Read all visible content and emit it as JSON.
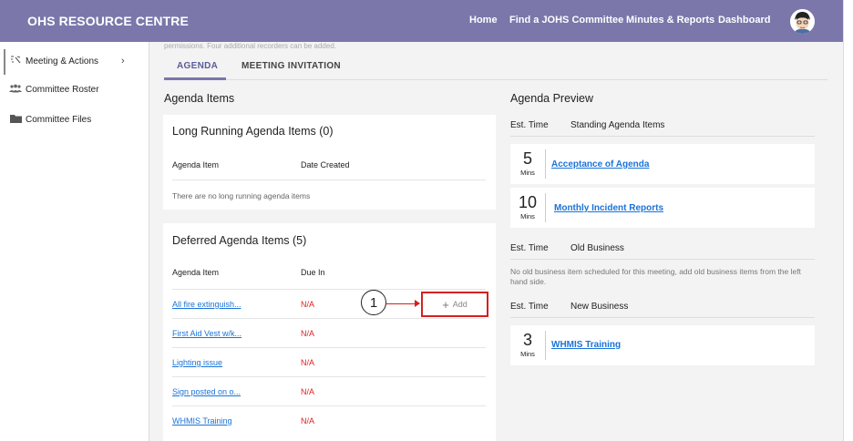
{
  "header": {
    "brand": "OHS RESOURCE CENTRE",
    "nav": [
      "Home",
      "Find a JOHS Committee",
      "Minutes & Reports",
      "Dashboard"
    ]
  },
  "sidebar": {
    "items": [
      {
        "label": "Meeting & Actions",
        "icon": "meeting-icon"
      },
      {
        "label": "Committee Roster",
        "icon": "people-icon"
      },
      {
        "label": "Committee Files",
        "icon": "folder-icon"
      }
    ]
  },
  "main": {
    "faded_note": "permissions. Four additional recorders can be added.",
    "tabs": [
      "AGENDA",
      "MEETING INVITATION"
    ],
    "agenda_items_title": "Agenda Items",
    "long_running": {
      "title": "Long Running Agenda Items (0)",
      "col_item": "Agenda Item",
      "col_date": "Date Created",
      "empty": "There are no long running agenda items"
    },
    "deferred": {
      "title": "Deferred Agenda Items (5)",
      "col_item": "Agenda Item",
      "col_due": "Due In",
      "rows": [
        {
          "item": "All fire extinguish...",
          "due": "N/A"
        },
        {
          "item": "First Aid Vest w/k...",
          "due": "N/A"
        },
        {
          "item": "Lighting issue",
          "due": "N/A"
        },
        {
          "item": "Sign posted on o...",
          "due": "N/A"
        },
        {
          "item": "WHMIS Training",
          "due": "N/A"
        }
      ],
      "add_label": "Add",
      "callout": "1"
    }
  },
  "preview": {
    "title": "Agenda Preview",
    "est_time": "Est. Time",
    "standing": {
      "label": "Standing Agenda Items",
      "items": [
        {
          "mins": "5",
          "unit": "Mins",
          "title": "Acceptance of Agenda"
        },
        {
          "mins": "10",
          "unit": "Mins",
          "title": "Monthly Incident Reports"
        }
      ]
    },
    "old": {
      "label": "Old Business",
      "note": "No old business item scheduled for this meeting, add old business items from the left hand side."
    },
    "new": {
      "label": "New Business",
      "items": [
        {
          "mins": "3",
          "unit": "Mins",
          "title": "WHMIS Training"
        }
      ]
    }
  },
  "colors": {
    "header_bg": "#7b77ab",
    "link": "#1a73d8",
    "na_red": "#e02020",
    "highlight": "#d42020"
  }
}
